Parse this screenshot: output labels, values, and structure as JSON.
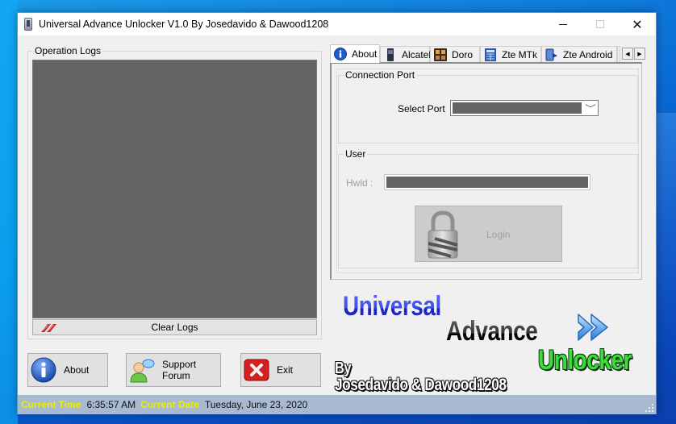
{
  "window": {
    "title": "Universal Advance Unlocker V1.0 By Josedavido & Dawood1208",
    "controls": {
      "minimize": "minimize",
      "maximize": "maximize",
      "close": "✕"
    }
  },
  "logs": {
    "group_label": "Operation Logs",
    "content": "",
    "clear_button": "Clear Logs"
  },
  "buttons": {
    "about": "About",
    "support_forum": "Support Forum",
    "exit": "Exit"
  },
  "tabs": [
    {
      "label": "About",
      "icon": "info-icon",
      "active": true
    },
    {
      "label": "Alcatel",
      "icon": "phone-icon",
      "active": false
    },
    {
      "label": "Doro",
      "icon": "doro-icon",
      "active": false
    },
    {
      "label": "Zte MTk",
      "icon": "calculator-icon",
      "active": false
    },
    {
      "label": "Zte Android",
      "icon": "android-phone-icon",
      "active": false
    }
  ],
  "tab_scroll": {
    "left": "◀",
    "right": "▶"
  },
  "connection": {
    "group_label": "Connection Port",
    "select_label": "Select Port",
    "selected_port": "",
    "chevron": "﹀"
  },
  "user": {
    "group_label": "User",
    "hwid_label": "Hwld  :",
    "hwid_value": "",
    "login_button": "Login"
  },
  "banner": {
    "line1": "Universal",
    "line2": "Advance",
    "line3": "Unlocker",
    "by": "By",
    "authors": "Josedavido & Dawood1208"
  },
  "status": {
    "time_label": "Current Time",
    "time_value": "6:35:57 AM",
    "date_label": "Current Date",
    "date_value": "Tuesday, June 23, 2020"
  },
  "colors": {
    "status_label": "#e8f000",
    "statusbar_bg": "#a9b9cf",
    "log_bg": "#646464",
    "banner_universal": "#2e3de0",
    "banner_unlocker": "#3cdc3c"
  }
}
